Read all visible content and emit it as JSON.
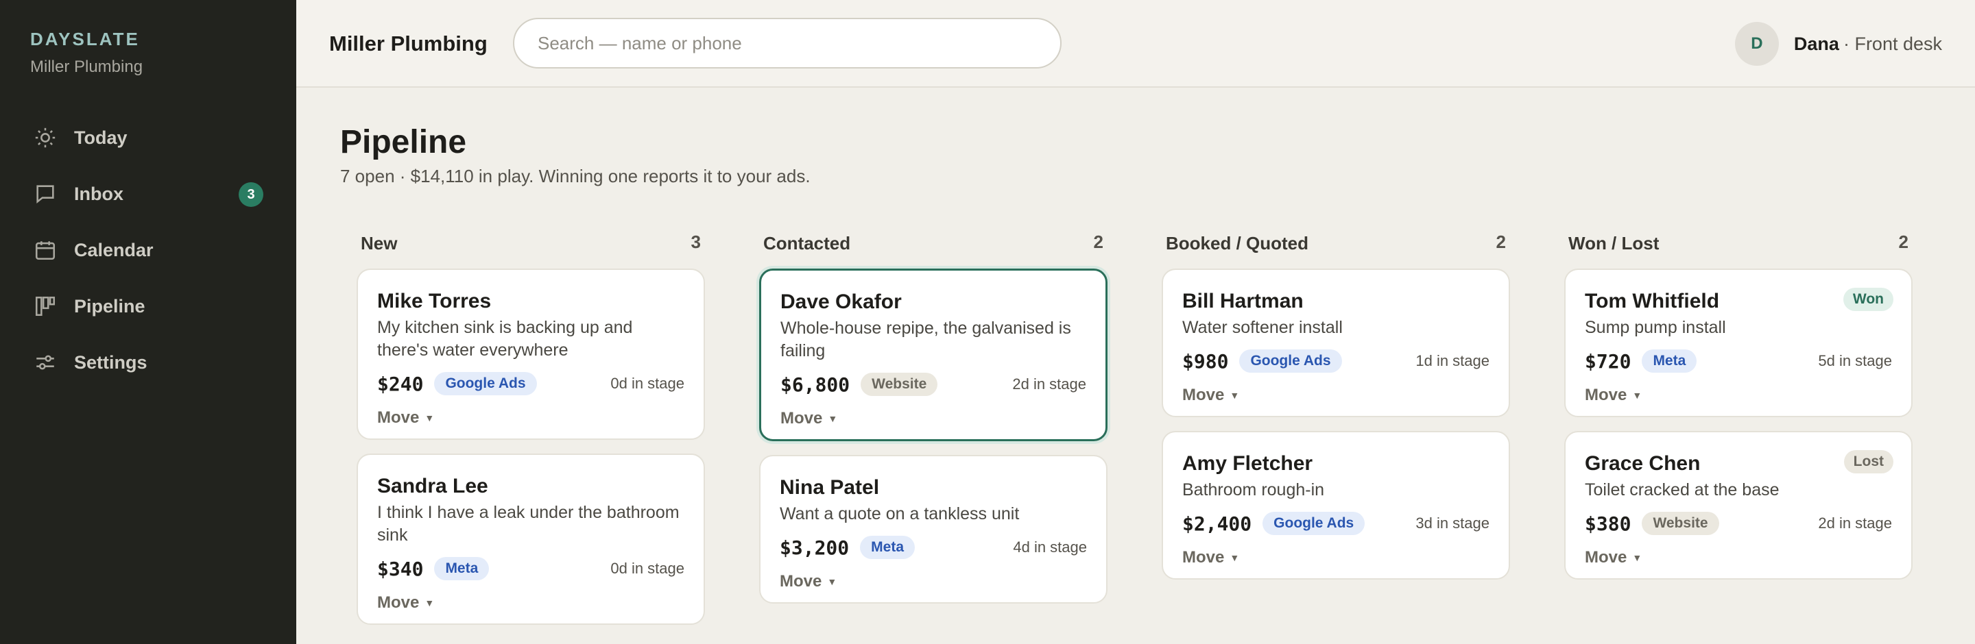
{
  "sidebar": {
    "brand": "DAYSLATE",
    "brand_sub": "Miller Plumbing",
    "items": [
      {
        "label": "Today",
        "icon": "sun-icon"
      },
      {
        "label": "Inbox",
        "icon": "chat-icon",
        "badge": "3"
      },
      {
        "label": "Calendar",
        "icon": "calendar-icon"
      },
      {
        "label": "Pipeline",
        "icon": "kanban-icon"
      },
      {
        "label": "Settings",
        "icon": "sliders-icon"
      }
    ]
  },
  "header": {
    "shop_name": "Miller Plumbing",
    "search_placeholder": "Search — name or phone",
    "user_initial": "D",
    "user_name": "Dana",
    "user_role": "· Front desk"
  },
  "main": {
    "title": "Pipeline",
    "subtitle": "7 open · $14,110 in play. Winning one reports it to your ads."
  },
  "columns": [
    {
      "name": "New",
      "count": "3",
      "cards": [
        {
          "name": "Mike Torres",
          "desc": "My kitchen sink is backing up and there's water everywhere",
          "amount": "$240",
          "source": "Google Ads",
          "stage": "0d in stage",
          "move": "Move"
        },
        {
          "name": "Sandra Lee",
          "desc": "I think I have a leak under the bathroom sink",
          "amount": "$340",
          "source": "Meta",
          "stage": "0d in stage",
          "move": "Move"
        }
      ]
    },
    {
      "name": "Contacted",
      "count": "2",
      "cards": [
        {
          "name": "Dave Okafor",
          "desc": "Whole-house repipe, the galvanised is failing",
          "amount": "$6,800",
          "source": "Website",
          "stage": "2d in stage",
          "move": "Move"
        },
        {
          "name": "Nina Patel",
          "desc": "Want a quote on a tankless unit",
          "amount": "$3,200",
          "source": "Meta",
          "stage": "4d in stage",
          "move": "Move"
        }
      ]
    },
    {
      "name": "Booked / Quoted",
      "count": "2",
      "cards": [
        {
          "name": "Bill Hartman",
          "desc": "Water softener install",
          "amount": "$980",
          "source": "Google Ads",
          "stage": "1d in stage",
          "move": "Move"
        },
        {
          "name": "Amy Fletcher",
          "desc": "Bathroom rough-in",
          "amount": "$2,400",
          "source": "Google Ads",
          "stage": "3d in stage",
          "move": "Move"
        }
      ]
    },
    {
      "name": "Won / Lost",
      "count": "2",
      "cards": [
        {
          "name": "Tom Whitfield",
          "desc": "Sump pump install",
          "amount": "$720",
          "source": "Meta",
          "stage": "5d in stage",
          "move": "Move",
          "status": "Won"
        },
        {
          "name": "Grace Chen",
          "desc": "Toilet cracked at the base",
          "amount": "$380",
          "source": "Website",
          "stage": "2d in stage",
          "move": "Move",
          "status": "Lost"
        }
      ]
    }
  ],
  "colors": {
    "sidebar_bg": "#22231e",
    "accent": "#2a6f5a",
    "brand": "#9ec4c0",
    "tag_ads": "#2a56b0"
  }
}
